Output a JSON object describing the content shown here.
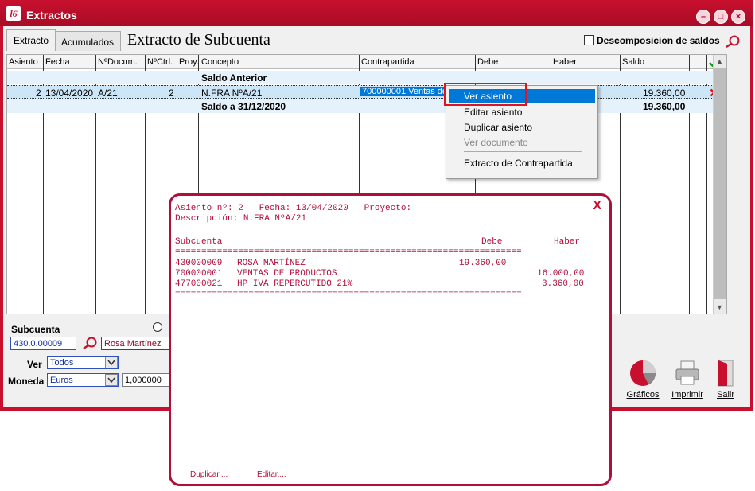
{
  "window": {
    "title": "Extractos",
    "logo": "l6"
  },
  "tabs": [
    {
      "label": "Extracto"
    },
    {
      "label": "Acumulados"
    }
  ],
  "page_title": "Extracto de Subcuenta",
  "descomposicion_label": "Descomposicion de saldos",
  "grid": {
    "columns": [
      "Asiento",
      "Fecha",
      "NºDocum.",
      "NºCtrl.",
      "Proy.",
      "Concepto",
      "Contrapartida",
      "Debe",
      "Haber",
      "Saldo"
    ],
    "rows": [
      {
        "asiento": "",
        "fecha": "",
        "documento": "",
        "control": "",
        "concepto": "Saldo Anterior",
        "contrapartida": "",
        "saldo": ""
      },
      {
        "asiento": "2",
        "fecha": "13/04/2020",
        "documento": "A/21",
        "control": "2",
        "concepto": "N.FRA NºA/21",
        "contrapartida": "700000001 Ventas de",
        "saldo": "19.360,00"
      },
      {
        "asiento": "",
        "fecha": "",
        "documento": "",
        "control": "",
        "concepto": "Saldo a 31/12/2020",
        "contrapartida": "",
        "saldo": "19.360,00"
      }
    ]
  },
  "context_menu": {
    "items": [
      {
        "label": "Ver asiento",
        "state": "selected"
      },
      {
        "label": "Editar asiento",
        "state": "normal"
      },
      {
        "label": "Duplicar asiento",
        "state": "normal"
      },
      {
        "label": "Ver documento",
        "state": "disabled"
      },
      {
        "label": "Extracto de Contrapartida",
        "state": "normal"
      }
    ]
  },
  "bottom": {
    "subcuenta_label": "Subcuenta",
    "subcuenta_value": "430.0.00009",
    "subcuenta_name": "Rosa Martínez",
    "ver_label": "Ver",
    "ver_value": "Todos",
    "moneda_label": "Moneda",
    "moneda_value": "Euros",
    "rate_value": "1,000000"
  },
  "tools": [
    {
      "label": "Gráficos"
    },
    {
      "label": "Imprimir"
    },
    {
      "label": "Salir"
    }
  ],
  "popup": {
    "header_line1": "Asiento nº: 2   Fecha: 13/04/2020   Proyecto:",
    "header_line2": "Descripción: N.FRA NºA/21",
    "col_subcuenta": "Subcuenta",
    "col_debe": "Debe",
    "col_haber": "Haber",
    "separator": "==================================================================",
    "lines": [
      {
        "cuenta": "430000009",
        "nombre": "ROSA MARTÍNEZ",
        "debe": "19.360,00",
        "haber": ""
      },
      {
        "cuenta": "700000001",
        "nombre": "VENTAS DE PRODUCTOS",
        "debe": "",
        "haber": "16.000,00"
      },
      {
        "cuenta": "477000021",
        "nombre": "HP IVA REPERCUTIDO 21%",
        "debe": "",
        "haber": "3.360,00"
      }
    ],
    "close_label": "X",
    "link_duplicar": "Duplicar....",
    "link_editar": "Editar...."
  },
  "colors": {
    "brand": "#c8102e",
    "selection": "#0078d7",
    "row_highlight": "#cde6f7"
  }
}
